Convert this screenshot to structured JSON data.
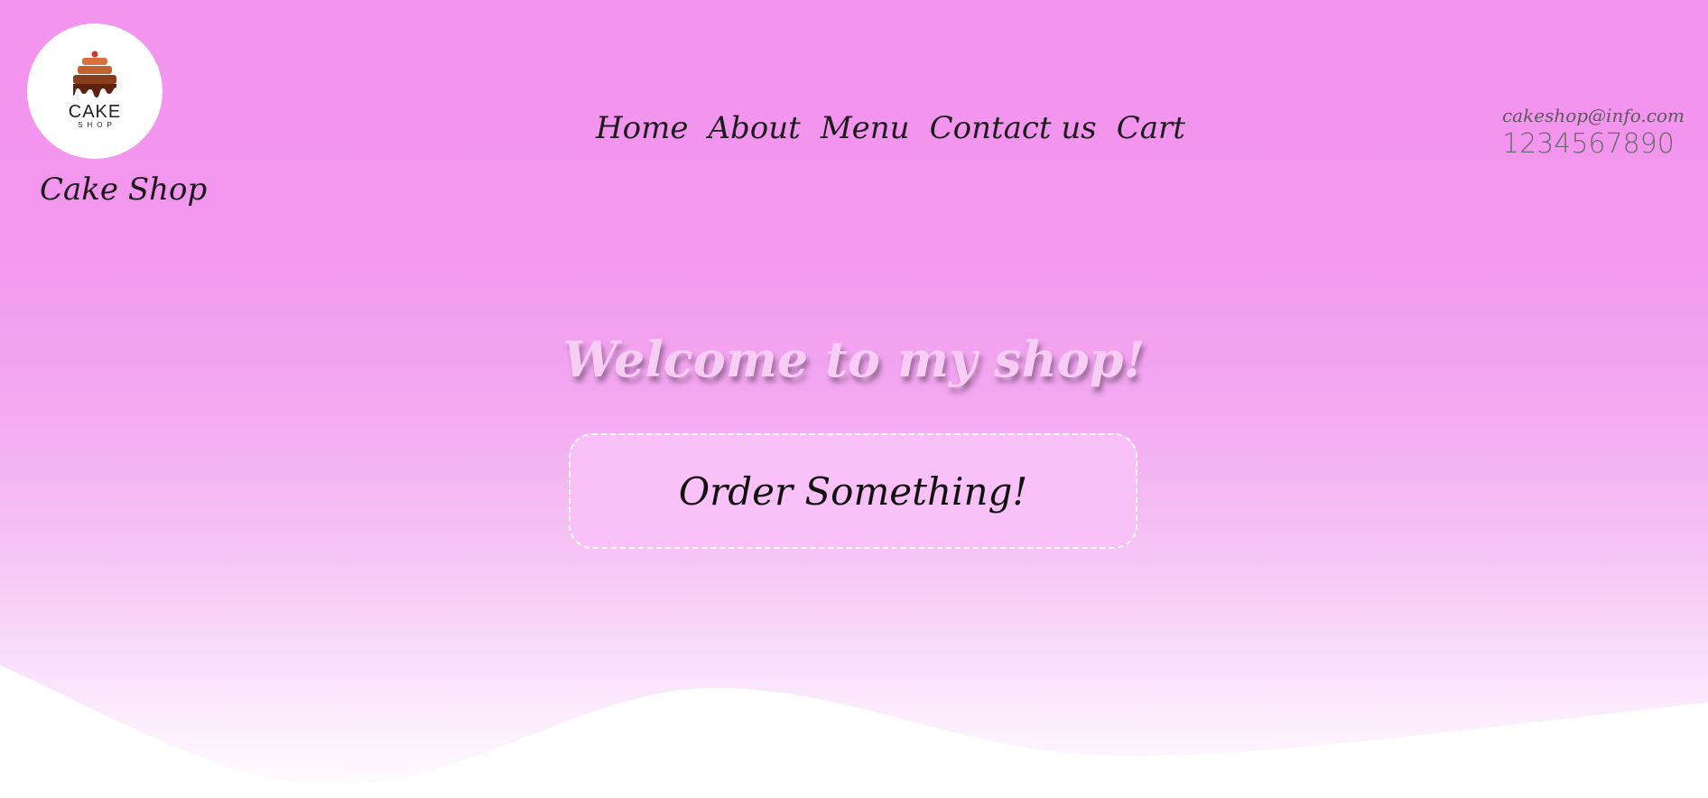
{
  "brand": {
    "logo_word": "CAKE",
    "logo_sub": "SHOP",
    "name": "Cake Shop",
    "icon": "cake-icon"
  },
  "nav": {
    "items": [
      {
        "label": "Home"
      },
      {
        "label": "About"
      },
      {
        "label": "Menu"
      },
      {
        "label": "Contact us"
      },
      {
        "label": "Cart"
      }
    ]
  },
  "contact": {
    "email": "cakeshop@info.com",
    "phone": "1234567890"
  },
  "hero": {
    "title": "Welcome to my shop!",
    "cta_label": "Order Something!"
  },
  "colors": {
    "background_top": "#f394ee",
    "background_bottom": "#ffffff",
    "cta_fill": "#f9c1f7",
    "hero_title": "#f7cdf4"
  }
}
